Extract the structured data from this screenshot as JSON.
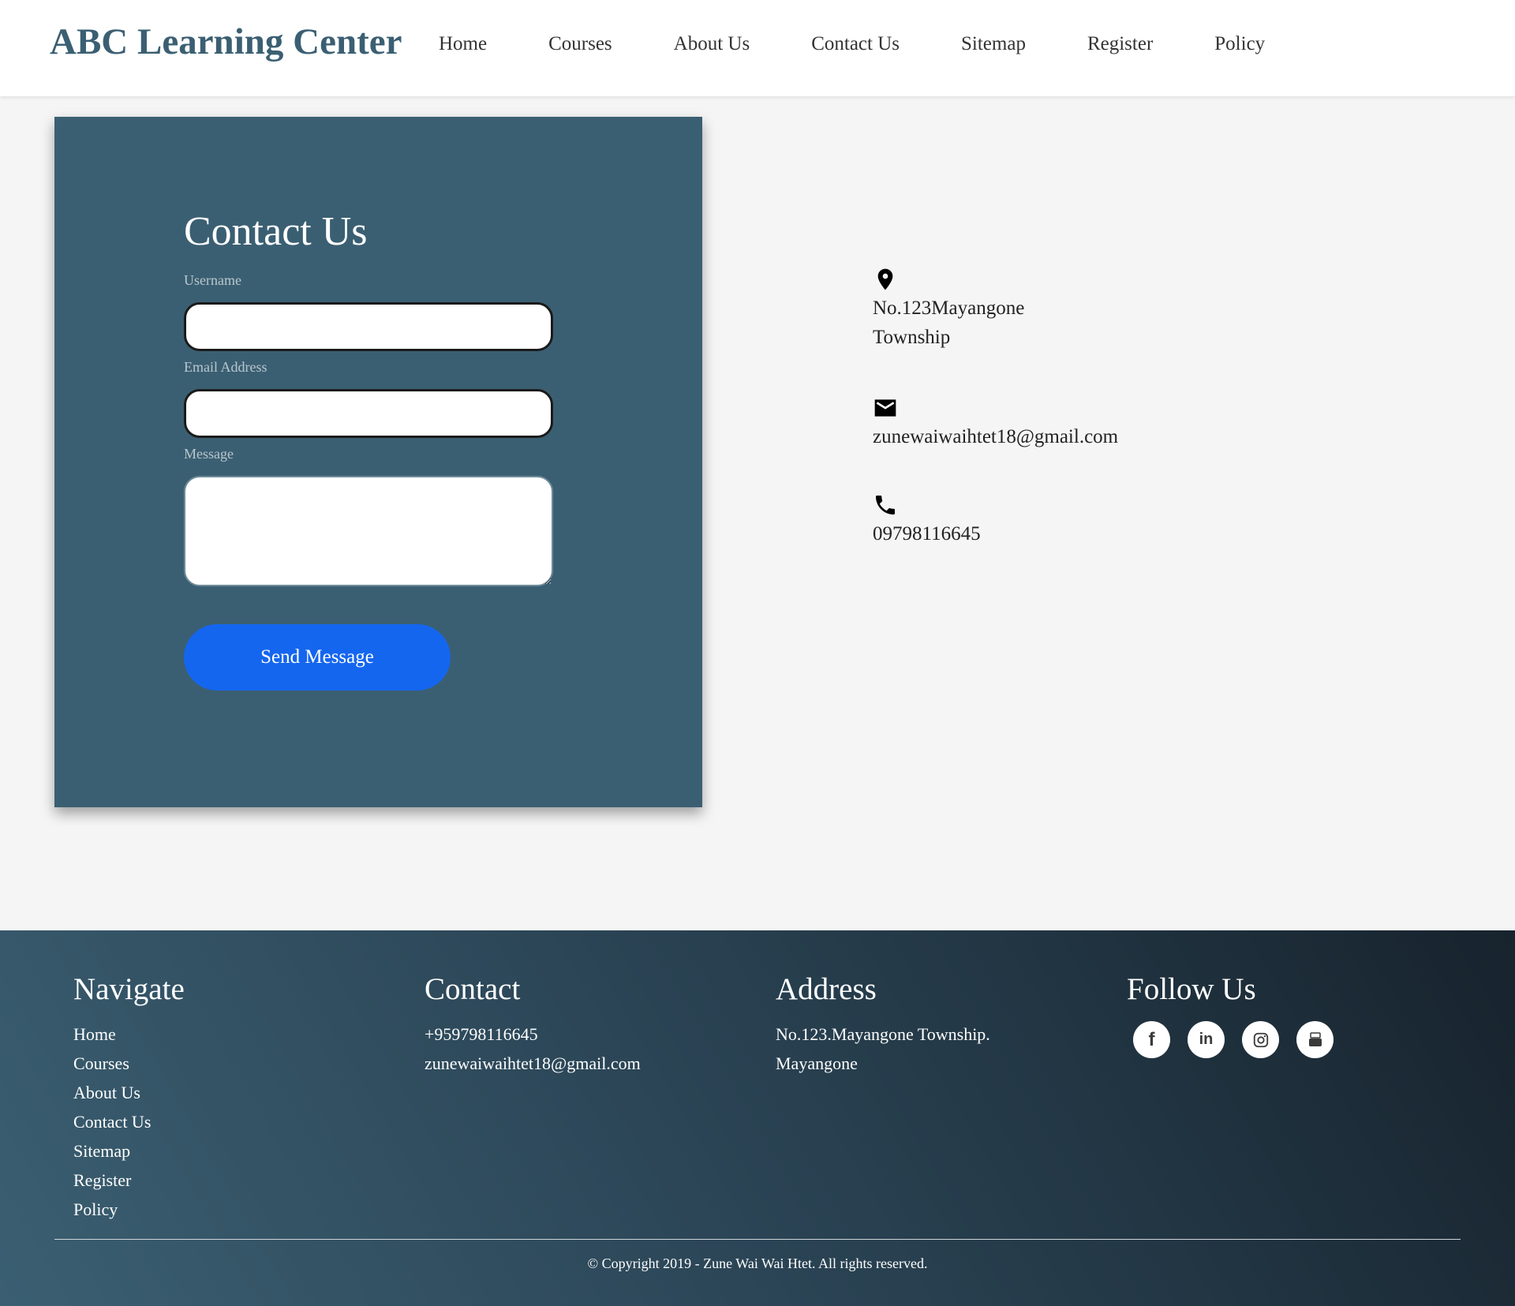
{
  "header": {
    "brand": "ABC Learning Center",
    "nav": [
      "Home",
      "Courses",
      "About Us",
      "Contact Us",
      "Sitemap",
      "Register",
      "Policy"
    ]
  },
  "contact_form": {
    "title": "Contact Us",
    "username_label": "Username",
    "username_value": "",
    "email_label": "Email Address",
    "email_value": "",
    "message_label": "Message",
    "message_value": "",
    "send_label": "Send Message"
  },
  "contact_info": {
    "address_line1": "No.123Mayangone",
    "address_line2": "Township",
    "email": "zunewaiwaihtet18@gmail.com",
    "phone": "09798116645",
    "icons": [
      "location-pin-icon",
      "envelope-icon",
      "phone-icon"
    ]
  },
  "footer": {
    "navigate": {
      "title": "Navigate",
      "links": [
        "Home",
        "Courses",
        "About Us",
        "Contact Us",
        "Sitemap",
        "Register",
        "Policy"
      ]
    },
    "contact": {
      "title": "Contact",
      "phone": "+959798116645",
      "email": "zunewaiwaihtet18@gmail.com"
    },
    "address": {
      "title": "Address",
      "line1": "No.123.Mayangone Township.",
      "line2": "Mayangone"
    },
    "follow": {
      "title": "Follow Us",
      "socials": [
        {
          "name": "facebook-icon",
          "glyph": "f"
        },
        {
          "name": "linkedin-icon",
          "glyph": "in"
        },
        {
          "name": "instagram-icon",
          "glyph": ""
        },
        {
          "name": "youtube-icon",
          "glyph": ""
        }
      ]
    },
    "copyright": "© Copyright 2019 - Zune Wai Wai Htet. All rights reserved."
  },
  "colors": {
    "brand": "#3b5f72",
    "card_bg": "#3b5f72",
    "button": "#1566ef",
    "page_bg": "#f5f5f5"
  }
}
